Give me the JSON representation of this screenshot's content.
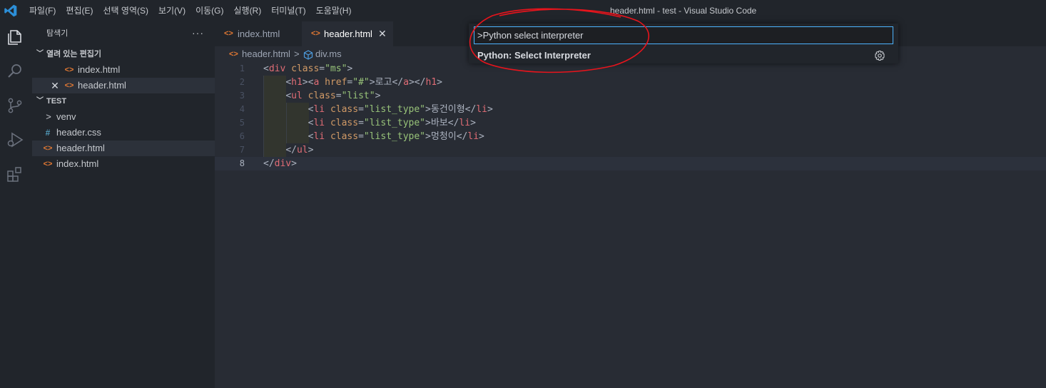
{
  "window": {
    "title": "header.html - test - Visual Studio Code",
    "menu": [
      "파일(F)",
      "편집(E)",
      "선택 영역(S)",
      "보기(V)",
      "이동(G)",
      "실행(R)",
      "터미널(T)",
      "도움말(H)"
    ]
  },
  "activitybar": {
    "icons": [
      "explorer-icon",
      "search-icon",
      "source-control-icon",
      "run-debug-icon",
      "extensions-icon"
    ]
  },
  "sidebar": {
    "title": "탐색기",
    "more": "···",
    "open_editors": {
      "label": "열려 있는 편집기",
      "items": [
        {
          "name": "index.html",
          "icon": "html-file-icon"
        },
        {
          "name": "header.html",
          "icon": "html-file-icon",
          "close": "✕"
        }
      ]
    },
    "folder": {
      "label": "TEST",
      "items": [
        {
          "name": "venv",
          "icon": "chevron-right-icon"
        },
        {
          "name": "header.css",
          "icon": "css-file-icon"
        },
        {
          "name": "header.html",
          "icon": "html-file-icon"
        },
        {
          "name": "index.html",
          "icon": "html-file-icon"
        }
      ]
    }
  },
  "tabs": [
    {
      "label": "index.html",
      "active": false
    },
    {
      "label": "header.html",
      "active": true,
      "close": "✕"
    }
  ],
  "breadcrumb": {
    "file": "header.html",
    "separator": ">",
    "symbol": "div.ms"
  },
  "editor": {
    "current_line": 8,
    "lines": [
      {
        "n": "1",
        "text": "<div class=\"ms\">"
      },
      {
        "n": "2",
        "text": "    <h1><a href=\"#\">로고</a></h1>"
      },
      {
        "n": "3",
        "text": "    <ul class=\"list\">"
      },
      {
        "n": "4",
        "text": "        <li class=\"list_type\">동건이형</li>"
      },
      {
        "n": "5",
        "text": "        <li class=\"list_type\">바보</li>"
      },
      {
        "n": "6",
        "text": "        <li class=\"list_type\">멍청이</li>"
      },
      {
        "n": "7",
        "text": "    </ul>"
      },
      {
        "n": "8",
        "text": "</div>"
      }
    ]
  },
  "quick_input": {
    "value": ">Python select interpreter",
    "result": "Python: Select Interpreter",
    "result_icon": "gear-icon"
  },
  "colors": {
    "accent": "#4db4ff",
    "annotation": "#e8141c",
    "html_icon": "#e37933",
    "css_icon": "#519aba"
  }
}
